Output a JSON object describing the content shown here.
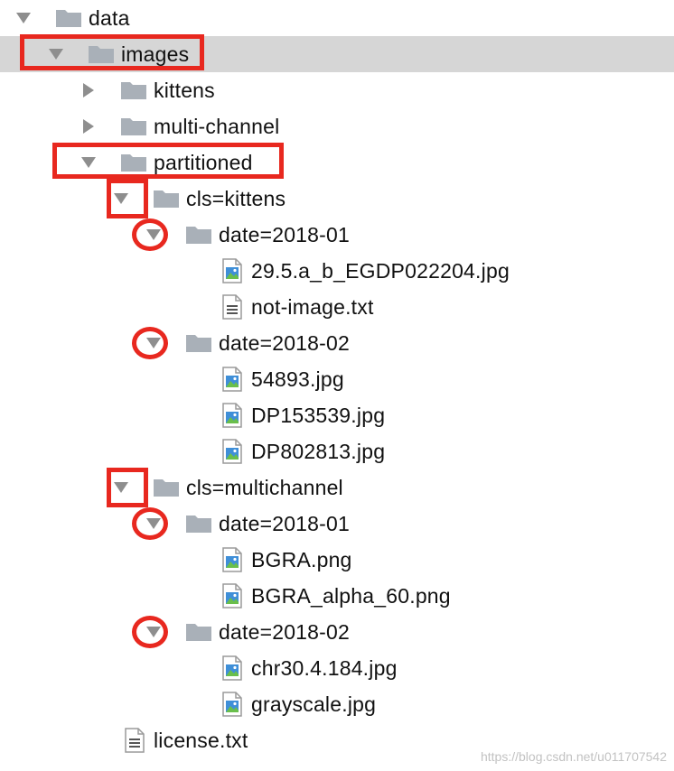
{
  "tree": {
    "rows": [
      {
        "id": "data",
        "label": "data",
        "kind": "folder",
        "expanded": true,
        "depth": 0
      },
      {
        "id": "images",
        "label": "images",
        "kind": "folder",
        "expanded": true,
        "depth": 1,
        "selected": true
      },
      {
        "id": "kittens",
        "label": "kittens",
        "kind": "folder",
        "expanded": false,
        "depth": 2
      },
      {
        "id": "multi-channel",
        "label": "multi-channel",
        "kind": "folder",
        "expanded": false,
        "depth": 2
      },
      {
        "id": "partitioned",
        "label": "partitioned",
        "kind": "folder",
        "expanded": true,
        "depth": 2
      },
      {
        "id": "cls-kittens",
        "label": "cls=kittens",
        "kind": "folder",
        "expanded": true,
        "depth": 3
      },
      {
        "id": "kittens-date-2018-01",
        "label": "date=2018-01",
        "kind": "folder",
        "expanded": true,
        "depth": 4
      },
      {
        "id": "file-29-5",
        "label": "29.5.a_b_EGDP022204.jpg",
        "kind": "image",
        "depth": 5
      },
      {
        "id": "file-not-image",
        "label": "not-image.txt",
        "kind": "text",
        "depth": 5
      },
      {
        "id": "kittens-date-2018-02",
        "label": "date=2018-02",
        "kind": "folder",
        "expanded": true,
        "depth": 4
      },
      {
        "id": "file-54893",
        "label": "54893.jpg",
        "kind": "image",
        "depth": 5
      },
      {
        "id": "file-dp153539",
        "label": "DP153539.jpg",
        "kind": "image",
        "depth": 5
      },
      {
        "id": "file-dp802813",
        "label": "DP802813.jpg",
        "kind": "image",
        "depth": 5
      },
      {
        "id": "cls-multichannel",
        "label": "cls=multichannel",
        "kind": "folder",
        "expanded": true,
        "depth": 3
      },
      {
        "id": "multi-date-2018-01",
        "label": "date=2018-01",
        "kind": "folder",
        "expanded": true,
        "depth": 4
      },
      {
        "id": "file-bgra",
        "label": "BGRA.png",
        "kind": "image",
        "depth": 5
      },
      {
        "id": "file-bgra-alpha",
        "label": "BGRA_alpha_60.png",
        "kind": "image",
        "depth": 5
      },
      {
        "id": "multi-date-2018-02",
        "label": "date=2018-02",
        "kind": "folder",
        "expanded": true,
        "depth": 4
      },
      {
        "id": "file-chr30",
        "label": "chr30.4.184.jpg",
        "kind": "image",
        "depth": 5
      },
      {
        "id": "file-grayscale",
        "label": "grayscale.jpg",
        "kind": "image",
        "depth": 5
      },
      {
        "id": "file-license",
        "label": "license.txt",
        "kind": "text",
        "depth": 2
      }
    ]
  },
  "annotations": {
    "color": "#e8281f",
    "highlighted_rows": [
      "images",
      "partitioned",
      "cls-kittens",
      "cls-multichannel"
    ],
    "circled_rows": [
      "kittens-date-2018-01",
      "kittens-date-2018-02",
      "multi-date-2018-01",
      "multi-date-2018-02"
    ]
  },
  "watermark": "https://blog.csdn.net/u011707542",
  "colors": {
    "selection": "#d6d6d6",
    "folder": "#a9b0b8",
    "arrow": "#8e8e8e",
    "image_icon_blue": "#3f8fd8",
    "image_icon_green": "#6abf4b"
  }
}
